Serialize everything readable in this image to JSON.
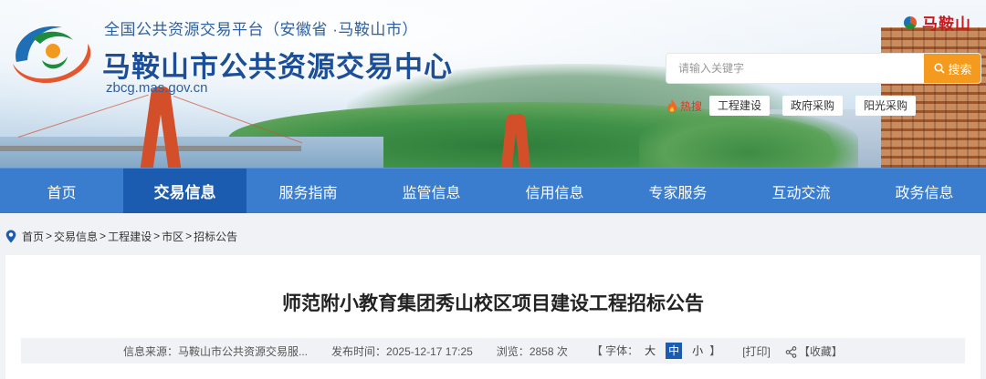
{
  "header": {
    "platform_line": "全国公共资源交易平台（安徽省 ·马鞍山市）",
    "site_title": "马鞍山市公共资源交易中心",
    "site_domain": "zbcg.mas.gov.cn",
    "building_sign": "马鞍山"
  },
  "search": {
    "placeholder": "请输入关键字",
    "button_label": "搜索"
  },
  "hot_search": {
    "label": "热搜",
    "tags": [
      "工程建设",
      "政府采购",
      "阳光采购"
    ]
  },
  "nav": {
    "items": [
      "首页",
      "交易信息",
      "服务指南",
      "监管信息",
      "信用信息",
      "专家服务",
      "互动交流",
      "政务信息"
    ],
    "active_index": 1
  },
  "breadcrumb": {
    "items": [
      "首页",
      "交易信息",
      "工程建设",
      "市区",
      "招标公告"
    ],
    "separator": ">"
  },
  "article": {
    "title": "师范附小教育集团秀山校区项目建设工程招标公告",
    "meta": {
      "source_label": "信息来源：",
      "source_value": "马鞍山市公共资源交易服...",
      "time_label": "发布时间：",
      "time_value": "2025-12-17 17:25",
      "views_label": "浏览：",
      "views_value": "2858 次",
      "font_open": "【 字体：",
      "font_large": "大",
      "font_medium": "中",
      "font_small": "小",
      "font_close": "】",
      "print": "[打印]",
      "favorite": "【收藏】"
    }
  },
  "colors": {
    "nav_bg": "#3a7dce",
    "nav_active": "#1c5cb0",
    "search_button": "#f39a1f",
    "title_blue": "#1d4f99",
    "hot_red": "#e3341e"
  }
}
